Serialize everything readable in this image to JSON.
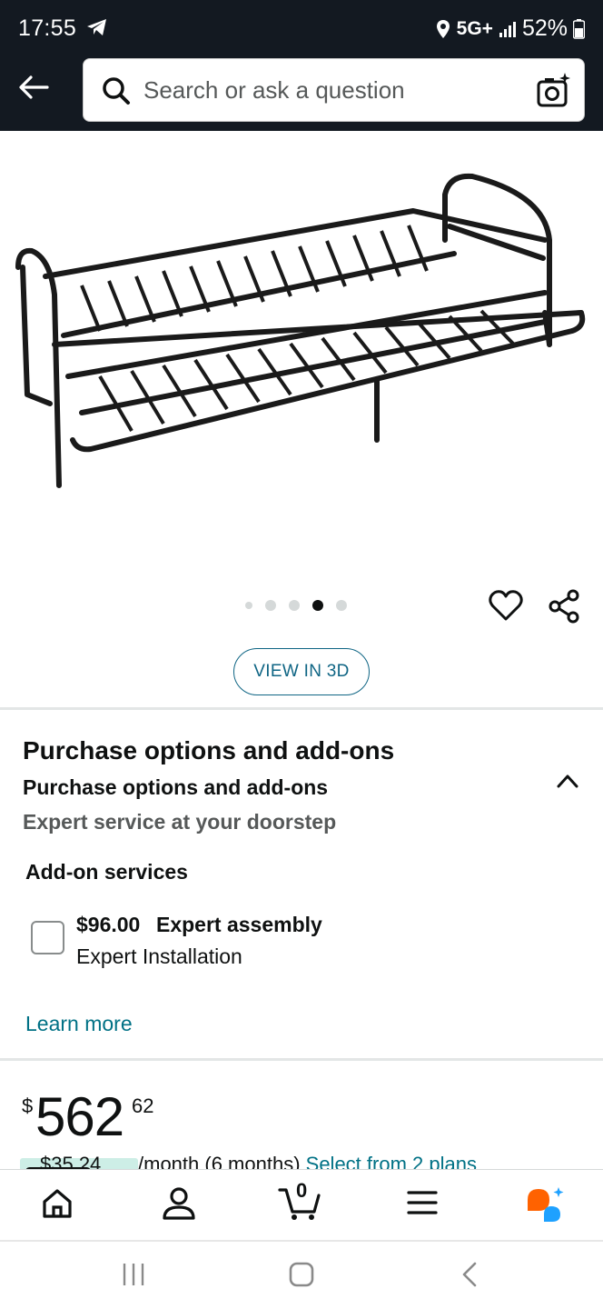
{
  "status_bar": {
    "time": "17:55",
    "network": "5G+",
    "battery": "52%"
  },
  "search": {
    "placeholder": "Search or ask a question"
  },
  "carousel": {
    "count": 5,
    "active_index": 3
  },
  "view_3d": {
    "label": "VIEW IN 3D"
  },
  "purchase_options": {
    "title": "Purchase options and add-ons",
    "subtitle": "Purchase options and add-ons",
    "description": "Expert service at your doorstep",
    "addons_title": "Add-on services",
    "addon": {
      "price": "$96.00",
      "name": "Expert assembly",
      "description": "Expert Installation",
      "checked": false
    },
    "learn_more": "Learn more"
  },
  "price": {
    "symbol": "$",
    "whole": "562",
    "fraction": "62"
  },
  "monthly": {
    "amount": "$35.24",
    "text": "/month (6 months)",
    "link": "Select from 2 plans"
  },
  "cart": {
    "count": "0"
  },
  "colors": {
    "header_bg": "#131921",
    "link": "#007185",
    "accent": "#0f6584",
    "badge_bg": "#cdeee6"
  },
  "icons": [
    "back-arrow-icon",
    "search-icon",
    "camera-icon",
    "heart-icon",
    "share-icon",
    "chevron-up-icon",
    "home-icon",
    "profile-icon",
    "cart-icon",
    "menu-icon",
    "rufus-icon",
    "recents-icon",
    "home-button-icon",
    "back-icon"
  ]
}
